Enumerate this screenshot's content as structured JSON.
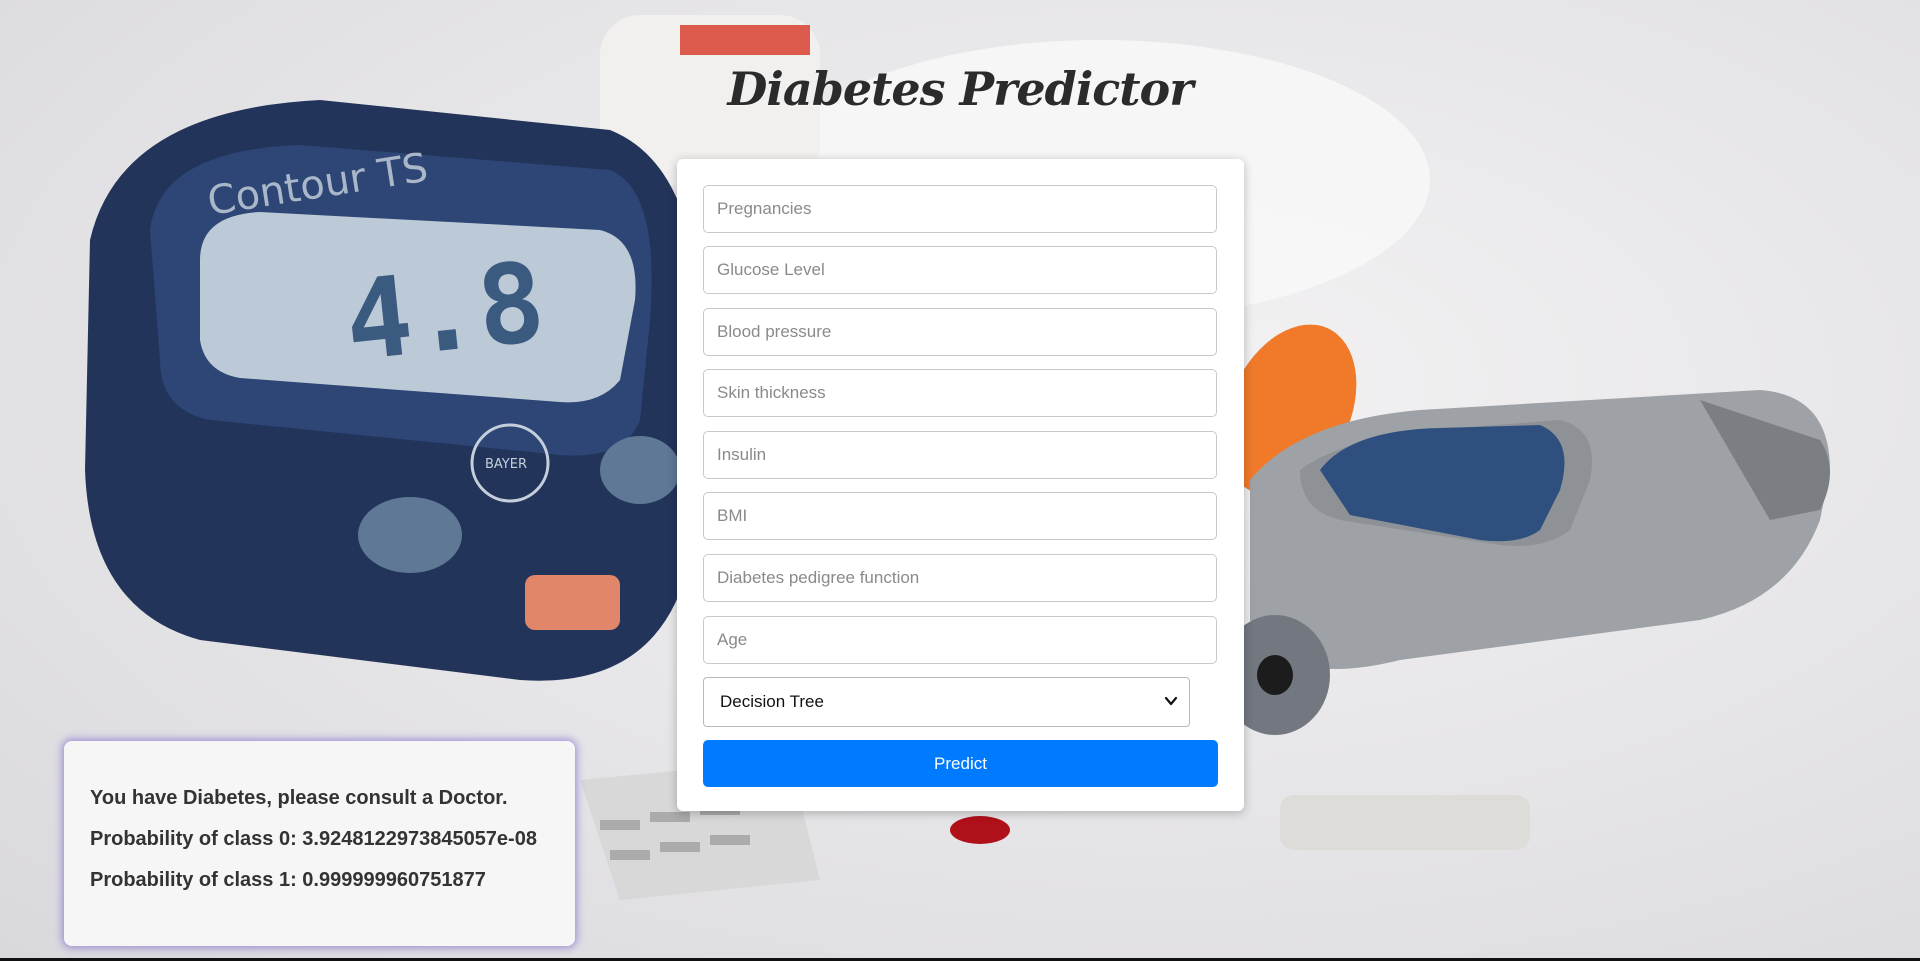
{
  "page": {
    "title": "Diabetes Predictor"
  },
  "form": {
    "fields": [
      {
        "placeholder": "Pregnancies",
        "value": ""
      },
      {
        "placeholder": "Glucose Level",
        "value": ""
      },
      {
        "placeholder": "Blood pressure",
        "value": ""
      },
      {
        "placeholder": "Skin thickness",
        "value": ""
      },
      {
        "placeholder": "Insulin",
        "value": ""
      },
      {
        "placeholder": "BMI",
        "value": ""
      },
      {
        "placeholder": "Diabetes pedigree function",
        "value": ""
      },
      {
        "placeholder": "Age",
        "value": ""
      }
    ],
    "model_select": {
      "selected": "Decision Tree"
    },
    "predict_label": "Predict",
    "predict_color": "#007bff"
  },
  "result": {
    "message": "You have Diabetes, please consult a Doctor.",
    "class0": "Probability of class 0: 3.9248122973845057e-08",
    "class1": "Probability of class 1: 0.999999960751877"
  },
  "background": {
    "meter_brand": "Contour TS",
    "meter_reading": "4.8",
    "maker": "BAYER"
  }
}
